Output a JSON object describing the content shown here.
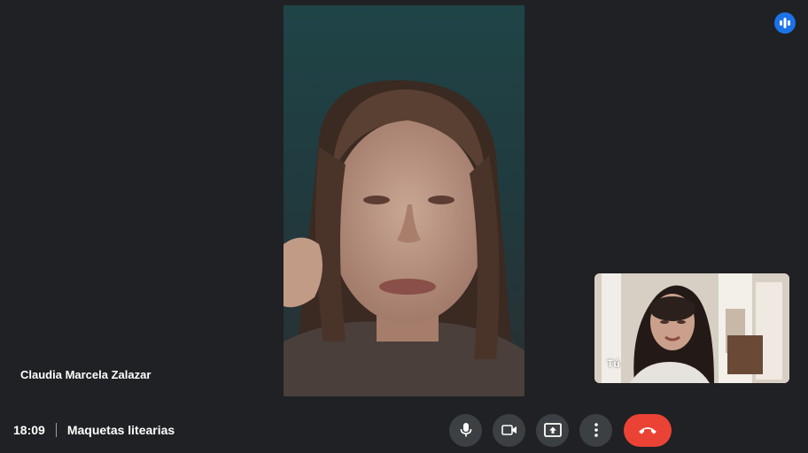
{
  "main_participant": {
    "name": "Claudia Marcela Zalazar"
  },
  "self_view": {
    "label": "Tú"
  },
  "meeting": {
    "time": "18:09",
    "title": "Maquetas litearias"
  },
  "controls": {
    "microphone": "microphone-icon",
    "camera": "camera-icon",
    "present": "present-screen-icon",
    "more": "more-options-icon",
    "hangup": "hang-up-icon"
  },
  "colors": {
    "background": "#202124",
    "control_button": "#3c4043",
    "hangup_button": "#ea4335",
    "activity_indicator": "#1a73e8"
  }
}
